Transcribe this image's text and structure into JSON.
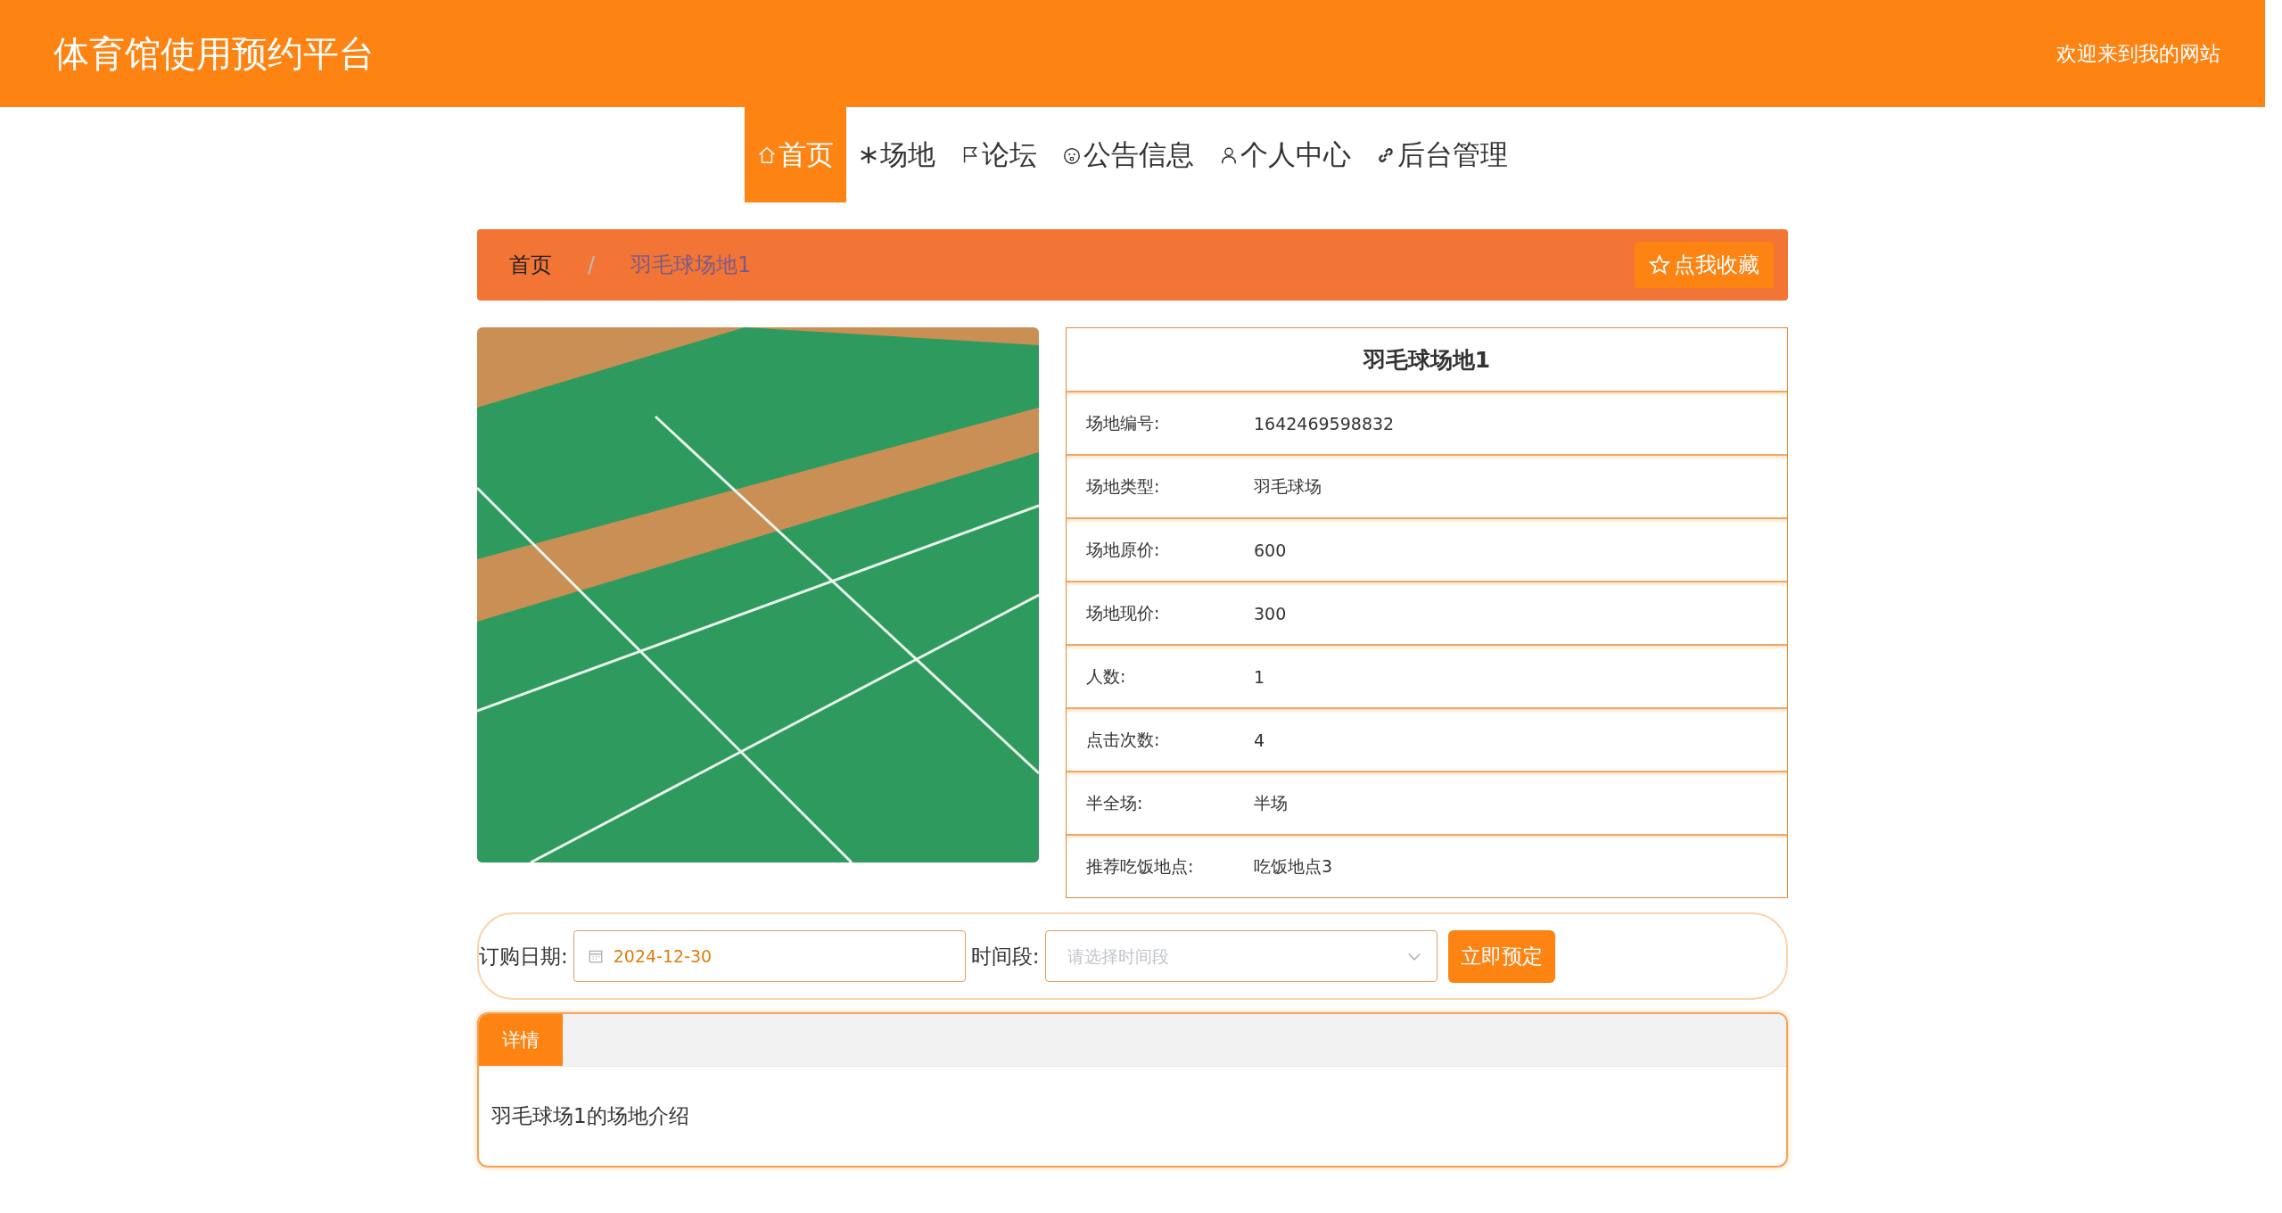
{
  "header": {
    "title": "体育馆使用预约平台",
    "welcome": "欢迎来到我的网站"
  },
  "nav": [
    {
      "label": "首页",
      "kind": "home",
      "selected": true
    },
    {
      "label": "场地",
      "kind": "snow",
      "selected": false
    },
    {
      "label": "论坛",
      "kind": "flag",
      "selected": false
    },
    {
      "label": "公告信息",
      "kind": "face",
      "selected": false
    },
    {
      "label": "个人中心",
      "kind": "user",
      "selected": false
    },
    {
      "label": "后台管理",
      "kind": "link",
      "selected": false
    }
  ],
  "breadcrumb": {
    "items": [
      "首页",
      "羽毛球场地1"
    ],
    "separator": "/",
    "favorite_button": "点我收藏"
  },
  "venue": {
    "title": "羽毛球场地1",
    "fields": [
      {
        "label": "场地编号:",
        "value": "1642469598832"
      },
      {
        "label": "场地类型:",
        "value": "羽毛球场"
      },
      {
        "label": "场地原价:",
        "value": "600"
      },
      {
        "label": "场地现价:",
        "value": "300"
      },
      {
        "label": "人数:",
        "value": "1"
      },
      {
        "label": "点击次数:",
        "value": "4"
      },
      {
        "label": "半全场:",
        "value": "半场"
      },
      {
        "label": "推荐吃饭地点:",
        "value": "吃饭地点3"
      }
    ]
  },
  "booking": {
    "date_label": "订购日期:",
    "date_value": "2024-12-30",
    "time_label": "时间段:",
    "time_placeholder": "请选择时间段",
    "submit": "立即预定"
  },
  "details": {
    "tabs": [
      {
        "label": "详情",
        "selected": true
      }
    ],
    "content": "羽毛球场1的场地介绍"
  }
}
